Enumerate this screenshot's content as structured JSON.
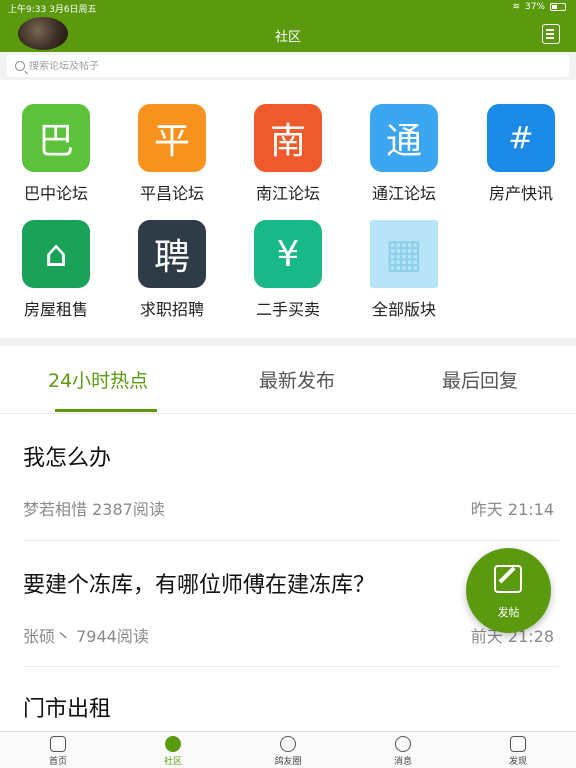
{
  "status_bar": {
    "time": "上午9:33",
    "date": "3月6日周五",
    "battery": "37%"
  },
  "header": {
    "title": "社区"
  },
  "search": {
    "placeholder": "搜索论坛及帖子"
  },
  "forums": [
    {
      "label": "巴中论坛",
      "glyph": "巴",
      "color": "#5cc23b"
    },
    {
      "label": "平昌论坛",
      "glyph": "平",
      "color": "#f7921e"
    },
    {
      "label": "南江论坛",
      "glyph": "南",
      "color": "#ee5a2b"
    },
    {
      "label": "通江论坛",
      "glyph": "通",
      "color": "#3ba5ef"
    },
    {
      "label": "房产快讯",
      "glyph": "#",
      "color": "#1a8ae6"
    },
    {
      "label": "房屋租售",
      "glyph": "⌂",
      "color": "#1aa358"
    },
    {
      "label": "求职招聘",
      "glyph": "聘",
      "color": "#2f3b47"
    },
    {
      "label": "二手买卖",
      "glyph": "¥",
      "color": "#19b889"
    },
    {
      "label": "全部版块",
      "glyph": "▦",
      "color": "#b8e4f7"
    }
  ],
  "tabs": [
    {
      "label": "24小时热点",
      "active": true
    },
    {
      "label": "最新发布",
      "active": false
    },
    {
      "label": "最后回复",
      "active": false
    }
  ],
  "posts": [
    {
      "title": "我怎么办",
      "author": "梦若相惜",
      "reads": "2387阅读",
      "time": "昨天 21:14"
    },
    {
      "title": "要建个冻库，有哪位师傅在建冻库？",
      "author": "张硕丶",
      "reads": "7944阅读",
      "time": "前天 21:28"
    },
    {
      "title": "门市出租",
      "author": "",
      "reads": "",
      "time": ""
    }
  ],
  "fab": {
    "label": "发帖"
  },
  "bottom_nav": [
    {
      "label": "首页",
      "active": false
    },
    {
      "label": "社区",
      "active": true
    },
    {
      "label": "鸽友圈",
      "active": false
    },
    {
      "label": "消息",
      "active": false
    },
    {
      "label": "发现",
      "active": false
    }
  ],
  "accent_color": "#5b9a0f"
}
